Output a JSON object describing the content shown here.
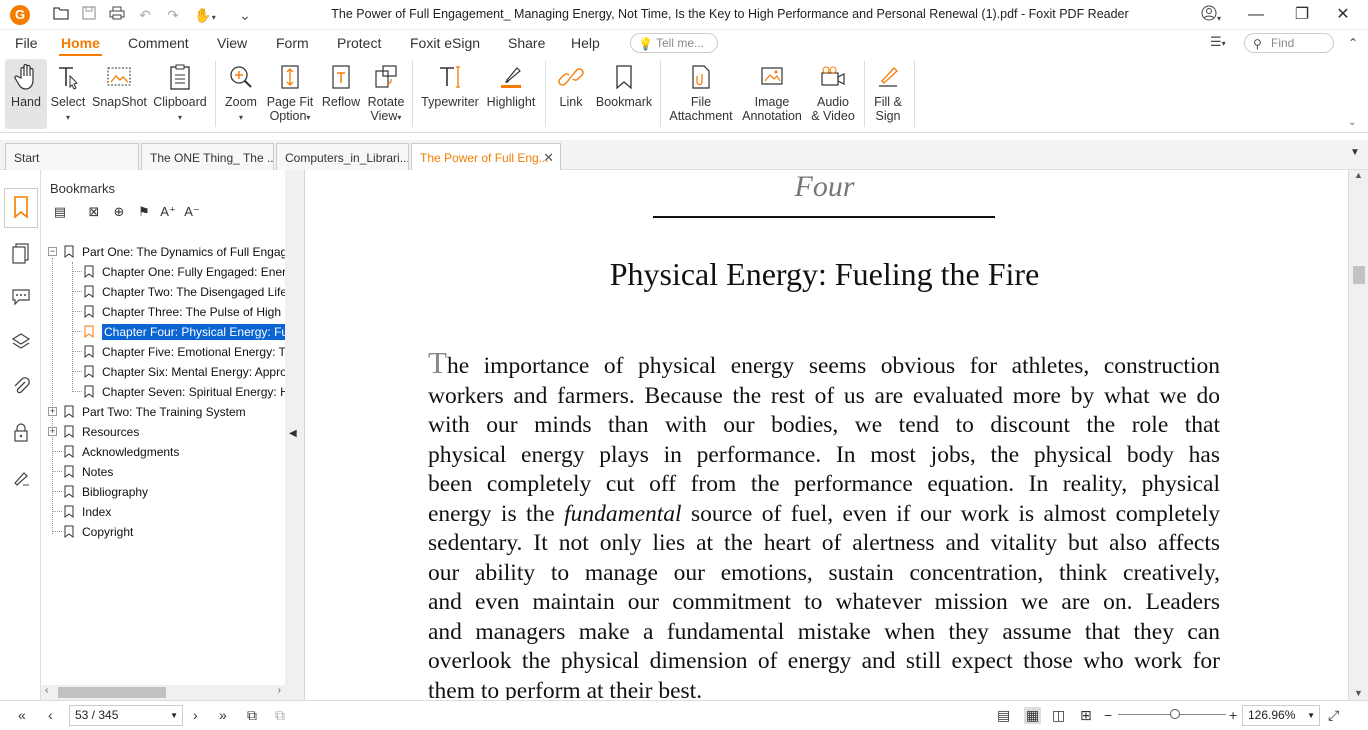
{
  "window": {
    "title": "The Power of Full Engagement_ Managing Energy, Not Time, Is the Key to High Performance and Personal Renewal  (1).pdf - Foxit PDF Reader"
  },
  "menu": {
    "items": [
      "File",
      "Home",
      "Comment",
      "View",
      "Form",
      "Protect",
      "Foxit eSign",
      "Share",
      "Help"
    ],
    "active": "Home",
    "tell_me_placeholder": "Tell me...",
    "find_placeholder": "Find"
  },
  "ribbon": {
    "hand": "Hand",
    "select": "Select",
    "snapshot": "SnapShot",
    "clipboard": "Clipboard",
    "zoom": "Zoom",
    "page_fit_1": "Page Fit",
    "page_fit_2": "Option",
    "reflow": "Reflow",
    "rotate_1": "Rotate",
    "rotate_2": "View",
    "typewriter": "Typewriter",
    "highlight": "Highlight",
    "link": "Link",
    "bookmark": "Bookmark",
    "file_attach_1": "File",
    "file_attach_2": "Attachment",
    "image_annot_1": "Image",
    "image_annot_2": "Annotation",
    "audio_video_1": "Audio",
    "audio_video_2": "& Video",
    "fill_sign_1": "Fill &",
    "fill_sign_2": "Sign"
  },
  "tabs": [
    {
      "label": "Start"
    },
    {
      "label": "The ONE Thing_ The ..."
    },
    {
      "label": "Computers_in_Librari..."
    },
    {
      "label": "The Power of Full Eng..."
    }
  ],
  "bookmarks": {
    "title": "Bookmarks",
    "items": [
      {
        "label": "Part One: The Dynamics of Full Engagement"
      },
      {
        "label": "Chapter One: Fully Engaged: Energy, Not Time"
      },
      {
        "label": "Chapter Two: The Disengaged Life"
      },
      {
        "label": "Chapter Three: The Pulse of High Performance"
      },
      {
        "label": "Chapter Four: Physical Energy: Fueling the Fire"
      },
      {
        "label": "Chapter Five: Emotional Energy: Transforming"
      },
      {
        "label": "Chapter Six: Mental Energy: Appropriate Focus"
      },
      {
        "label": "Chapter Seven: Spiritual Energy: He"
      },
      {
        "label": "Part Two: The Training System"
      },
      {
        "label": "Resources"
      },
      {
        "label": "Acknowledgments"
      },
      {
        "label": "Notes"
      },
      {
        "label": "Bibliography"
      },
      {
        "label": "Index"
      },
      {
        "label": "Copyright"
      }
    ]
  },
  "document": {
    "chapter_number": "Four",
    "chapter_title": "Physical Energy: Fueling the Fire",
    "drop_cap": "T",
    "lines": [
      "he importance of physical energy seems obvious for athletes, construction",
      "workers and farmers. Because the rest of us are evaluated more by what we do",
      "with our minds than with our bodies, we tend to discount the role that",
      "physical energy plays in performance. In most jobs, the physical body has",
      "been completely cut off from the performance equation. In reality, physical"
    ],
    "line6_a": "energy is the ",
    "line6_em": "fundamental",
    "line6_b": " source of fuel, even if our work is almost completely",
    "lines2": [
      "sedentary. It not only lies at the heart of alertness and vitality but also affects",
      "our ability to manage our emotions, sustain concentration, think creatively,",
      "and even maintain our commitment to whatever mission we are on. Leaders",
      "and managers make a fundamental mistake when they assume that they can",
      "overlook the physical dimension of energy and still expect those who work for",
      "them to perform at their best."
    ]
  },
  "status": {
    "page": "53 / 345",
    "zoom": "126.96%"
  },
  "colors": {
    "accent": "#f57c00",
    "selection": "#0a64d2"
  }
}
